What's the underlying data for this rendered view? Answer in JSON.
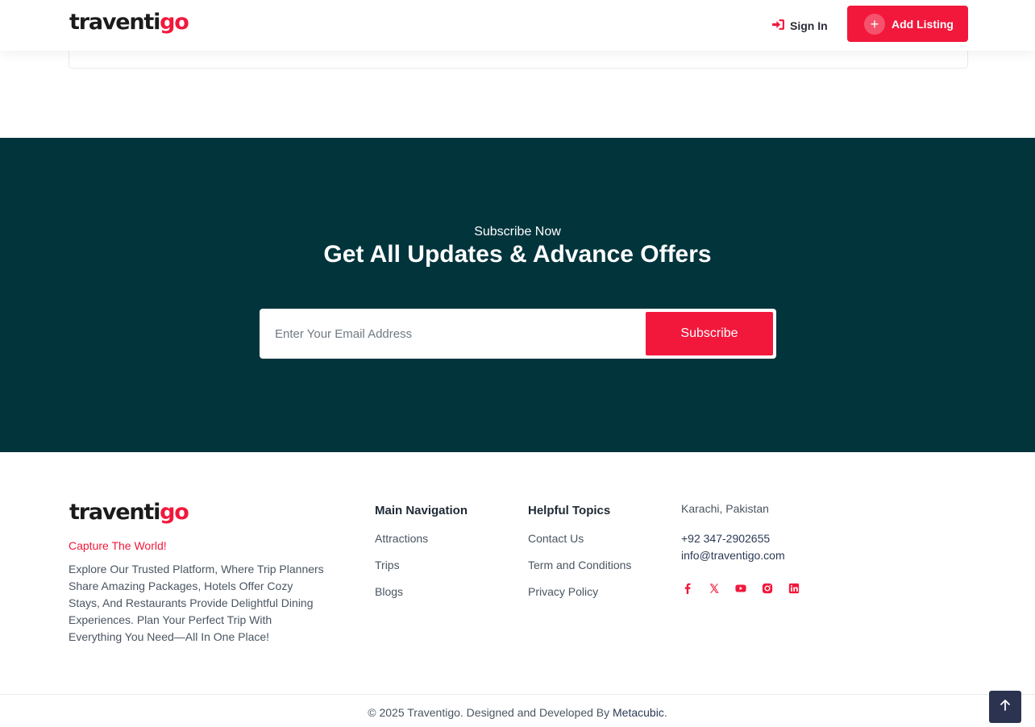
{
  "header": {
    "logo_main": "traventi",
    "logo_accent": "go",
    "signin_label": "Sign In",
    "add_listing_label": "Add Listing",
    "plus_glyph": "+"
  },
  "subscribe": {
    "kicker": "Subscribe Now",
    "title": "Get All Updates & Advance Offers",
    "email_placeholder": "Enter Your Email Address",
    "email_value": "",
    "button_label": "Subscribe"
  },
  "footer": {
    "logo_main": "traventi",
    "logo_accent": "go",
    "tagline": "Capture The World!",
    "about": "Explore Our Trusted Platform, Where Trip Planners Share Amazing Packages, Hotels Offer Cozy Stays, And Restaurants Provide Delightful Dining Experiences. Plan Your Perfect Trip With Everything You Need—All In One Place!",
    "main_nav": {
      "title": "Main Navigation",
      "links": [
        "Attractions",
        "Trips",
        "Blogs"
      ]
    },
    "helpful": {
      "title": "Helpful Topics",
      "links": [
        "Contact Us",
        "Term and Conditions",
        "Privacy Policy"
      ]
    },
    "contact": {
      "address": "Karachi, Pakistan",
      "phone": "+92 347-2902655",
      "email": "info@traventigo.com"
    },
    "socials": [
      "facebook-icon",
      "x-icon",
      "youtube-icon",
      "instagram-icon",
      "linkedin-icon"
    ],
    "copyright_prefix": "© 2025 Traventigo. Designed and Developed By ",
    "developer": "Metacubic",
    "copyright_suffix": "."
  },
  "colors": {
    "accent": "#f2183c",
    "subscribe_bg": "#02343c",
    "to_top_bg": "#2b3350"
  }
}
